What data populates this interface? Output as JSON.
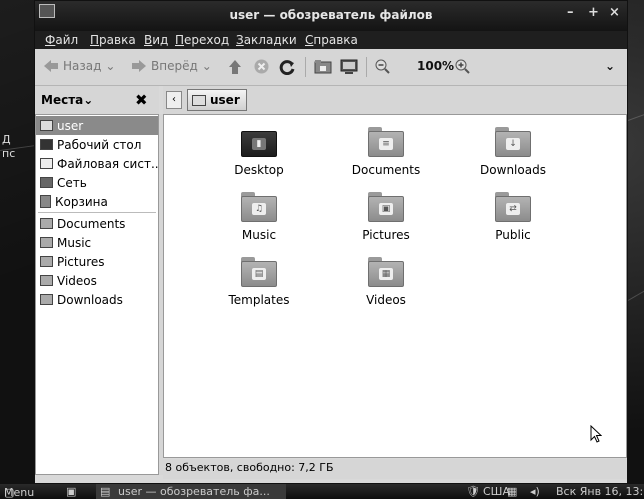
{
  "desktop": {
    "label_line1": "Д",
    "label_line2": "пс"
  },
  "window": {
    "title": "user — обозреватель файлов",
    "controls": {
      "minimize": "–",
      "maximize": "+",
      "close": "×"
    }
  },
  "menu": [
    "Файл",
    "Правка",
    "Вид",
    "Переход",
    "Закладки",
    "Справка"
  ],
  "toolbar": {
    "back_label": "Назад",
    "forward_label": "Вперёд",
    "zoom_level": "100%"
  },
  "places": {
    "header": "Места",
    "items": [
      {
        "label": "user",
        "icon": "home-icon"
      },
      {
        "label": "Рабочий стол",
        "icon": "desktop-icon"
      },
      {
        "label": "Файловая сист...",
        "icon": "filesystem-icon"
      },
      {
        "label": "Сеть",
        "icon": "network-icon"
      },
      {
        "label": "Корзина",
        "icon": "trash-icon"
      },
      {
        "label": "Documents",
        "icon": "folder-icon"
      },
      {
        "label": "Music",
        "icon": "folder-icon"
      },
      {
        "label": "Pictures",
        "icon": "folder-icon"
      },
      {
        "label": "Videos",
        "icon": "folder-icon"
      },
      {
        "label": "Downloads",
        "icon": "folder-icon"
      }
    ]
  },
  "path": {
    "current": "user"
  },
  "files": [
    {
      "name": "Desktop",
      "icon": "desktop-folder-icon"
    },
    {
      "name": "Documents",
      "icon": "documents-folder-icon"
    },
    {
      "name": "Downloads",
      "icon": "downloads-folder-icon"
    },
    {
      "name": "Music",
      "icon": "music-folder-icon"
    },
    {
      "name": "Pictures",
      "icon": "pictures-folder-icon"
    },
    {
      "name": "Public",
      "icon": "public-folder-icon"
    },
    {
      "name": "Templates",
      "icon": "templates-folder-icon"
    },
    {
      "name": "Videos",
      "icon": "videos-folder-icon"
    }
  ],
  "status": "8 объектов, свободно: 7,2 ГБ",
  "taskbar": {
    "menu_label": "Menu",
    "window_label": "user — обозреватель фа...",
    "keyboard_layout": "США",
    "clock": "Вск Янв 16, 13:"
  }
}
